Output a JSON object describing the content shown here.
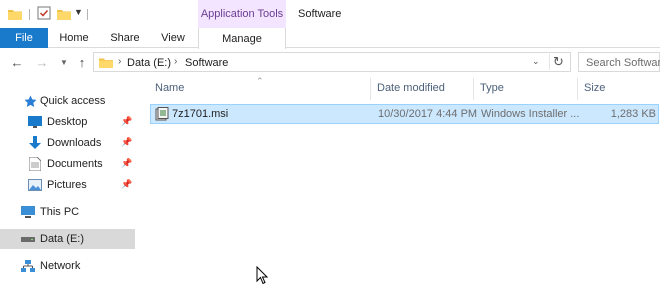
{
  "title_bar": {
    "context_tab_group": "Application Tools",
    "window_title": "Software"
  },
  "ribbon": {
    "tabs": [
      {
        "label": "File"
      },
      {
        "label": "Home"
      },
      {
        "label": "Share"
      },
      {
        "label": "View"
      },
      {
        "label": "Manage"
      }
    ]
  },
  "address_bar": {
    "breadcrumbs": [
      "Data (E:)",
      "Software"
    ]
  },
  "search": {
    "placeholder": "Search Software"
  },
  "nav_pane": {
    "items": [
      {
        "label": "Quick access",
        "icon": "star-icon"
      },
      {
        "label": "Desktop",
        "icon": "desktop-icon",
        "pinned": true
      },
      {
        "label": "Downloads",
        "icon": "download-icon",
        "pinned": true
      },
      {
        "label": "Documents",
        "icon": "documents-icon",
        "pinned": true
      },
      {
        "label": "Pictures",
        "icon": "pictures-icon",
        "pinned": true
      },
      {
        "label": "This PC",
        "icon": "computer-icon"
      },
      {
        "label": "Data (E:)",
        "icon": "drive-icon",
        "selected": true
      },
      {
        "label": "Network",
        "icon": "network-icon"
      }
    ]
  },
  "file_list": {
    "columns": [
      "Name",
      "Date modified",
      "Type",
      "Size"
    ],
    "rows": [
      {
        "name": "7z1701.msi",
        "date": "10/30/2017 4:44 PM",
        "type": "Windows Installer ...",
        "size": "1,283 KB",
        "selected": true
      }
    ]
  },
  "colors": {
    "accent": "#1979ca",
    "selection_bg": "#cce8ff",
    "selection_border": "#99d1ff",
    "context_tab": "#f3e4ff"
  }
}
